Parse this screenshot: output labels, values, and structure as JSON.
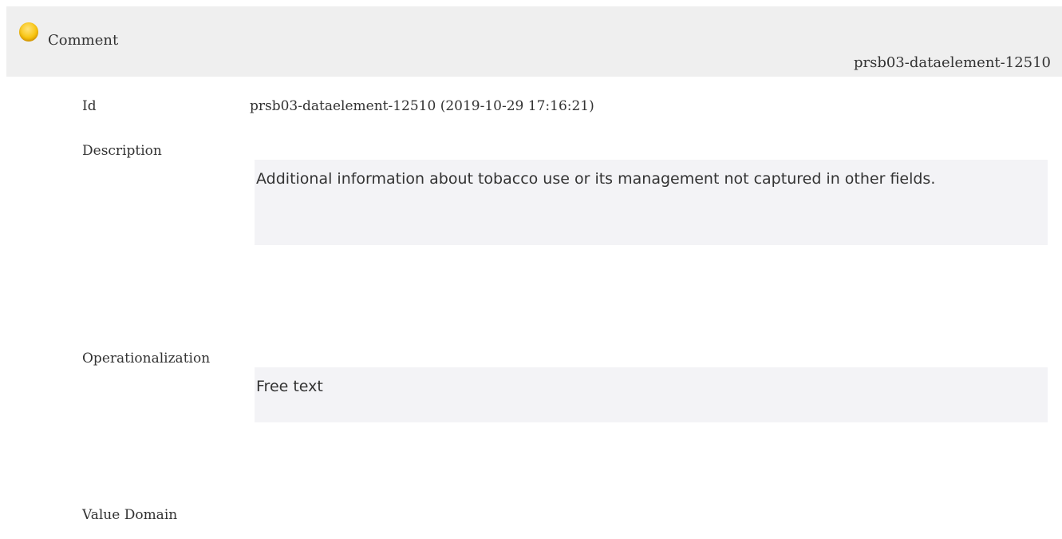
{
  "header": {
    "title": "Comment",
    "element_id": "prsb03-dataelement-12510",
    "status_color": "#f8c40e"
  },
  "fields": {
    "id": {
      "label": "Id",
      "value": "prsb03-dataelement-12510 (2019-10-29 17:16:21)"
    },
    "description": {
      "label": "Description",
      "value": "Additional information about tobacco use or its management not captured in other fields."
    },
    "operationalization": {
      "label": "Operationalization",
      "value": "Free text"
    },
    "value_domain": {
      "label": "Value Domain"
    }
  }
}
